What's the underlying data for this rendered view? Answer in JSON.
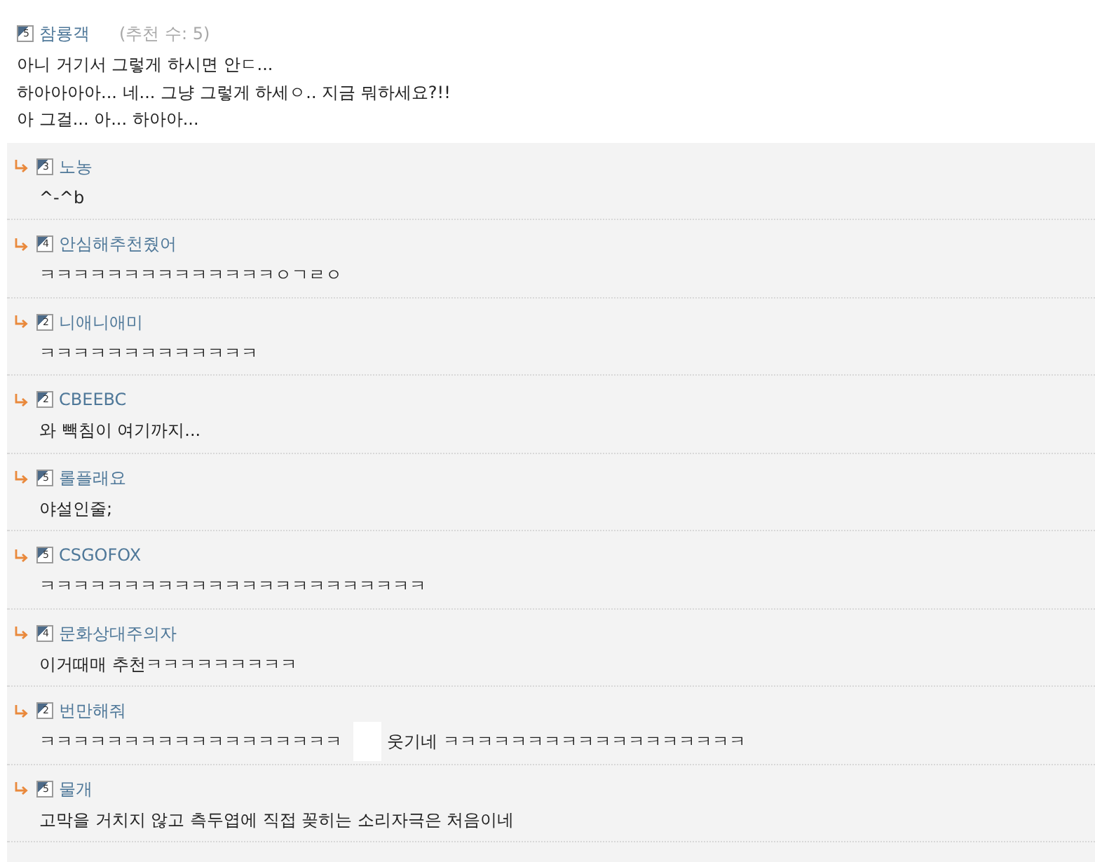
{
  "comment": {
    "rank": "5",
    "author": "참룡객",
    "recommend_count": "(추천 수: 5)",
    "lines": [
      "아니 거기서 그렇게 하시면 안ㄷ...",
      "하아아아아... 네... 그냥 그렇게 하세ㅇ.. 지금 뭐하세요?!!",
      "아 그걸... 아... 하아아..."
    ]
  },
  "replies": [
    {
      "rank": "3",
      "author": "노농",
      "body": [
        {
          "kind": "text",
          "text": "^-^b"
        }
      ]
    },
    {
      "rank": "4",
      "author": "안심해추천줬어",
      "body": [
        {
          "kind": "text",
          "text": "ㅋㅋㅋㅋㅋㅋㅋㅋㅋㅋㅋㅋㅋㅋㅇㄱㄹㅇ"
        }
      ]
    },
    {
      "rank": "2",
      "author": "니애니애미",
      "body": [
        {
          "kind": "text",
          "text": "ㅋㅋㅋㅋㅋㅋㅋㅋㅋㅋㅋㅋㅋ"
        }
      ]
    },
    {
      "rank": "2",
      "author": "CBEEBC",
      "body": [
        {
          "kind": "text",
          "text": "와 빽침이 여기까지..."
        }
      ]
    },
    {
      "rank": "5",
      "author": "롤플래요",
      "body": [
        {
          "kind": "text",
          "text": "야설인줄;"
        }
      ]
    },
    {
      "rank": "5",
      "author": "CSGOFOX",
      "body": [
        {
          "kind": "text",
          "text": "ㅋㅋㅋㅋㅋㅋㅋㅋㅋㅋㅋㅋㅋㅋㅋㅋㅋㅋㅋㅋㅋㅋㅋ"
        }
      ]
    },
    {
      "rank": "4",
      "author": "문화상대주의자",
      "body": [
        {
          "kind": "text",
          "text": "이거때매 추천ㅋㅋㅋㅋㅋㅋㅋㅋㅋ"
        }
      ]
    },
    {
      "rank": "2",
      "author": "번만해줘",
      "body": [
        {
          "kind": "text",
          "text": "ㅋㅋㅋㅋㅋㅋㅋㅋㅋㅋㅋㅋㅋㅋㅋㅋㅋㅋ"
        },
        {
          "kind": "redaction"
        },
        {
          "kind": "text",
          "text": "웃기네 ㅋㅋㅋㅋㅋㅋㅋㅋㅋㅋㅋㅋㅋㅋㅋㅋㅋㅋ"
        }
      ]
    },
    {
      "rank": "5",
      "author": "물개",
      "body": [
        {
          "kind": "text",
          "text": "고막을 거치지 않고 측두엽에 직접 꽂히는 소리자극은 처음이네"
        }
      ]
    }
  ]
}
